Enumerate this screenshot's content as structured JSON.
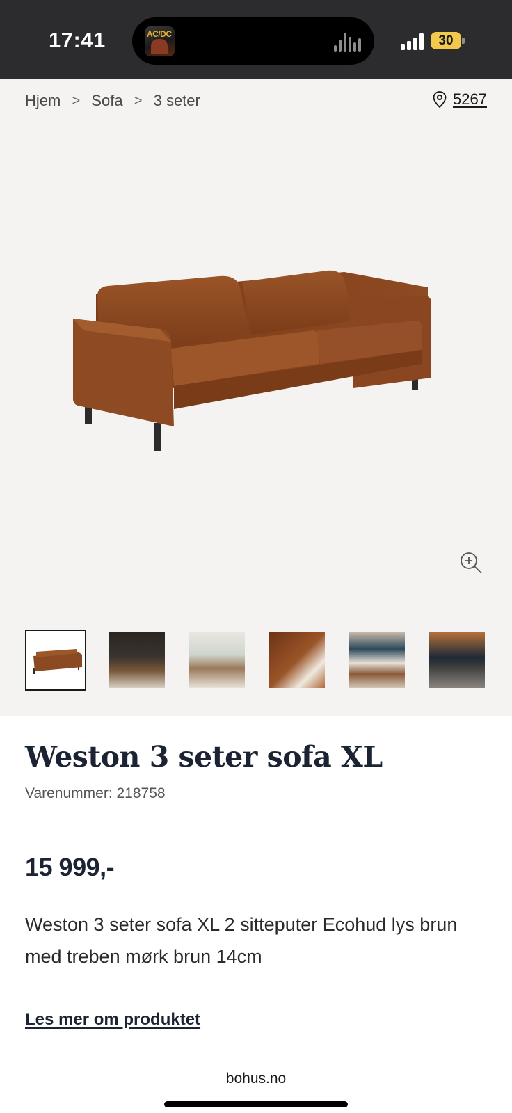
{
  "status_bar": {
    "time": "17:41",
    "album_art_text": "AC/DC",
    "battery": "30"
  },
  "breadcrumb": {
    "items": [
      "Hjem",
      "Sofa",
      "3 seter"
    ],
    "separator": ">"
  },
  "store": {
    "icon": "location-pin-icon",
    "number": "5267"
  },
  "gallery": {
    "main_image": "brown-leather-3-seat-sofa",
    "thumbnail_count": 6,
    "selected_index": 0
  },
  "product": {
    "title": "Weston 3 seter sofa XL",
    "sku": "Varenummer: 218758",
    "price": "15 999,-",
    "description": "Weston 3 seter sofa XL 2 sitteputer Ecohud lys brun med treben mørk brun 14cm",
    "read_more": "Les mer om produktet"
  },
  "browser": {
    "url": "bohus.no"
  },
  "colors": {
    "status_bar_bg": "#2c2c2e",
    "gallery_bg": "#f5f3f1",
    "sofa_brown": "#8b4a22",
    "title_navy": "#1c2433",
    "battery_yellow": "#f2c94c"
  }
}
